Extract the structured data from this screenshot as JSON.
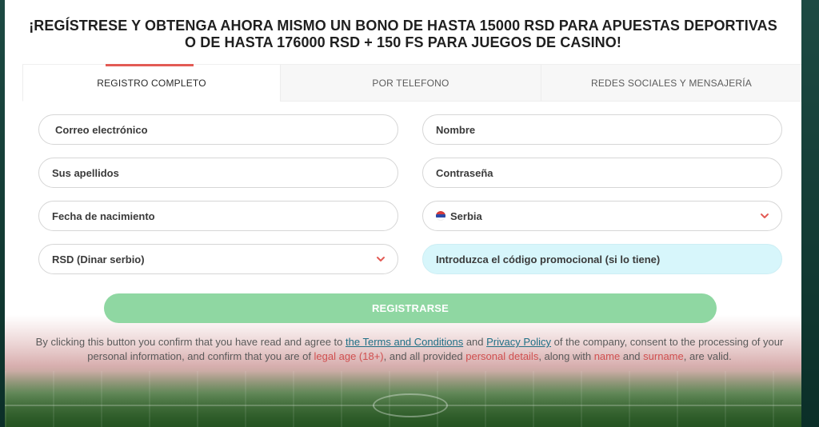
{
  "page": {
    "headline": "¡REGÍSTRESE Y OBTENGA AHORA MISMO UN BONO DE HASTA 15000 RSD PARA APUESTAS DEPORTIVAS O DE HASTA 176000 RSD + 150 FS PARA JUEGOS DE CASINO!"
  },
  "tabs": [
    {
      "label": "REGISTRO COMPLETO",
      "active": true
    },
    {
      "label": "POR TELEFONO",
      "active": false
    },
    {
      "label": "REDES SOCIALES Y MENSAJERÍA",
      "active": false
    }
  ],
  "form": {
    "email": {
      "placeholder": "Correo electrónico"
    },
    "first_name": {
      "placeholder": "Nombre"
    },
    "last_name": {
      "placeholder": "Sus apellidos"
    },
    "password": {
      "placeholder": "Contraseña"
    },
    "birthdate": {
      "placeholder": "Fecha de nacimiento"
    },
    "country": {
      "value": "Serbia",
      "flag_icon": "serbia-flag-icon"
    },
    "currency": {
      "value": "RSD (Dinar serbio)"
    },
    "promo": {
      "placeholder": "Introduzca el código promocional (si lo tiene)"
    }
  },
  "actions": {
    "register_label": "REGISTRARSE"
  },
  "legal": {
    "p1": "By clicking this button you confirm that you have read and agree to ",
    "terms_link": "the Terms and Conditions",
    "and": " and ",
    "privacy_link": "Privacy Policy",
    "p2": " of the company, consent to the processing of your personal information, and confirm that you are of ",
    "legal_age": "legal age (18+)",
    "p3": ", and all provided ",
    "personal_details": "personal details",
    "p4": ", along with ",
    "name": "name",
    "p5": " and ",
    "surname": "surname",
    "p6": ", are valid."
  },
  "colors": {
    "accent": "#e35b55",
    "register_button": "#8fd7a2",
    "promo_bg": "#d7f6fb",
    "link": "#1f6f86"
  }
}
